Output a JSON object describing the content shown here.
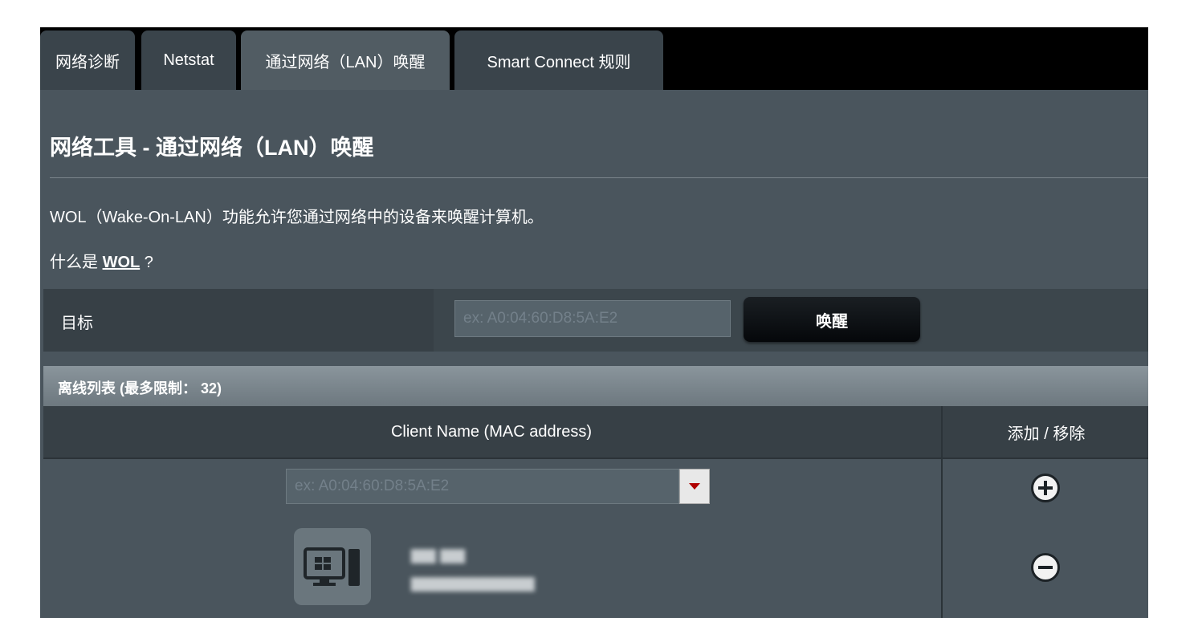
{
  "tabs": [
    {
      "label": "网络诊断",
      "active": false
    },
    {
      "label": "Netstat",
      "active": false
    },
    {
      "label": "通过网络（LAN）唤醒",
      "active": true
    },
    {
      "label": "Smart Connect 规则",
      "active": false
    }
  ],
  "page_title": "网络工具 - 通过网络（LAN）唤醒",
  "description": "WOL（Wake-On-LAN）功能允许您通过网络中的设备来唤醒计算机。",
  "whatis": {
    "prefix": "什么是 ",
    "link": "WOL",
    "suffix": " ?"
  },
  "target": {
    "label": "目标",
    "placeholder": "ex: A0:04:60:D8:5A:E2",
    "wake_button": "唤醒"
  },
  "offline_list": {
    "header": "离线列表 (最多限制： 32)",
    "columns": {
      "client": "Client Name (MAC address)",
      "action": "添加 / 移除"
    },
    "input_placeholder": "ex: A0:04:60:D8:5A:E2",
    "clients": [
      {
        "name_line1": "▆▆ ▆▆",
        "name_line2": "▆▆▆▆▆▆▆▆▆▆",
        "icon": "windows-pc-icon"
      }
    ]
  },
  "colors": {
    "accent_dropdown": "#b00000",
    "panel": "#4a555d",
    "tabbar": "#000000"
  },
  "icons": {
    "add": "plus-circle-icon",
    "remove": "minus-circle-icon"
  }
}
